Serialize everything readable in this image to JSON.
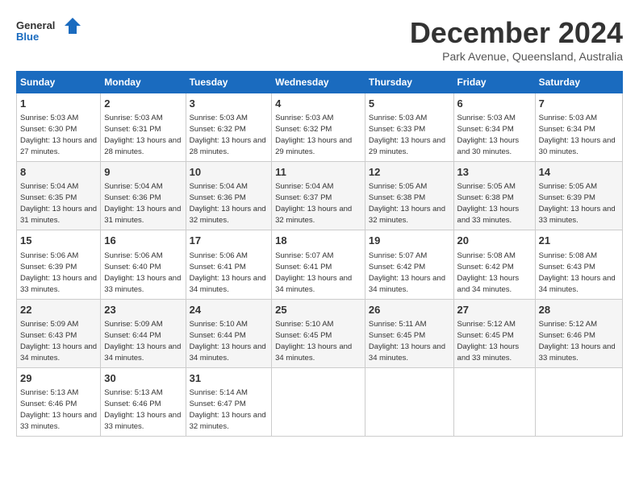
{
  "logo": {
    "general": "General",
    "blue": "Blue"
  },
  "title": "December 2024",
  "subtitle": "Park Avenue, Queensland, Australia",
  "days_header": [
    "Sunday",
    "Monday",
    "Tuesday",
    "Wednesday",
    "Thursday",
    "Friday",
    "Saturday"
  ],
  "weeks": [
    [
      {
        "day": "1",
        "sunrise": "5:03 AM",
        "sunset": "6:30 PM",
        "daylight": "13 hours and 27 minutes."
      },
      {
        "day": "2",
        "sunrise": "5:03 AM",
        "sunset": "6:31 PM",
        "daylight": "13 hours and 28 minutes."
      },
      {
        "day": "3",
        "sunrise": "5:03 AM",
        "sunset": "6:32 PM",
        "daylight": "13 hours and 28 minutes."
      },
      {
        "day": "4",
        "sunrise": "5:03 AM",
        "sunset": "6:32 PM",
        "daylight": "13 hours and 29 minutes."
      },
      {
        "day": "5",
        "sunrise": "5:03 AM",
        "sunset": "6:33 PM",
        "daylight": "13 hours and 29 minutes."
      },
      {
        "day": "6",
        "sunrise": "5:03 AM",
        "sunset": "6:34 PM",
        "daylight": "13 hours and 30 minutes."
      },
      {
        "day": "7",
        "sunrise": "5:03 AM",
        "sunset": "6:34 PM",
        "daylight": "13 hours and 30 minutes."
      }
    ],
    [
      {
        "day": "8",
        "sunrise": "5:04 AM",
        "sunset": "6:35 PM",
        "daylight": "13 hours and 31 minutes."
      },
      {
        "day": "9",
        "sunrise": "5:04 AM",
        "sunset": "6:36 PM",
        "daylight": "13 hours and 31 minutes."
      },
      {
        "day": "10",
        "sunrise": "5:04 AM",
        "sunset": "6:36 PM",
        "daylight": "13 hours and 32 minutes."
      },
      {
        "day": "11",
        "sunrise": "5:04 AM",
        "sunset": "6:37 PM",
        "daylight": "13 hours and 32 minutes."
      },
      {
        "day": "12",
        "sunrise": "5:05 AM",
        "sunset": "6:38 PM",
        "daylight": "13 hours and 32 minutes."
      },
      {
        "day": "13",
        "sunrise": "5:05 AM",
        "sunset": "6:38 PM",
        "daylight": "13 hours and 33 minutes."
      },
      {
        "day": "14",
        "sunrise": "5:05 AM",
        "sunset": "6:39 PM",
        "daylight": "13 hours and 33 minutes."
      }
    ],
    [
      {
        "day": "15",
        "sunrise": "5:06 AM",
        "sunset": "6:39 PM",
        "daylight": "13 hours and 33 minutes."
      },
      {
        "day": "16",
        "sunrise": "5:06 AM",
        "sunset": "6:40 PM",
        "daylight": "13 hours and 33 minutes."
      },
      {
        "day": "17",
        "sunrise": "5:06 AM",
        "sunset": "6:41 PM",
        "daylight": "13 hours and 34 minutes."
      },
      {
        "day": "18",
        "sunrise": "5:07 AM",
        "sunset": "6:41 PM",
        "daylight": "13 hours and 34 minutes."
      },
      {
        "day": "19",
        "sunrise": "5:07 AM",
        "sunset": "6:42 PM",
        "daylight": "13 hours and 34 minutes."
      },
      {
        "day": "20",
        "sunrise": "5:08 AM",
        "sunset": "6:42 PM",
        "daylight": "13 hours and 34 minutes."
      },
      {
        "day": "21",
        "sunrise": "5:08 AM",
        "sunset": "6:43 PM",
        "daylight": "13 hours and 34 minutes."
      }
    ],
    [
      {
        "day": "22",
        "sunrise": "5:09 AM",
        "sunset": "6:43 PM",
        "daylight": "13 hours and 34 minutes."
      },
      {
        "day": "23",
        "sunrise": "5:09 AM",
        "sunset": "6:44 PM",
        "daylight": "13 hours and 34 minutes."
      },
      {
        "day": "24",
        "sunrise": "5:10 AM",
        "sunset": "6:44 PM",
        "daylight": "13 hours and 34 minutes."
      },
      {
        "day": "25",
        "sunrise": "5:10 AM",
        "sunset": "6:45 PM",
        "daylight": "13 hours and 34 minutes."
      },
      {
        "day": "26",
        "sunrise": "5:11 AM",
        "sunset": "6:45 PM",
        "daylight": "13 hours and 34 minutes."
      },
      {
        "day": "27",
        "sunrise": "5:12 AM",
        "sunset": "6:45 PM",
        "daylight": "13 hours and 33 minutes."
      },
      {
        "day": "28",
        "sunrise": "5:12 AM",
        "sunset": "6:46 PM",
        "daylight": "13 hours and 33 minutes."
      }
    ],
    [
      {
        "day": "29",
        "sunrise": "5:13 AM",
        "sunset": "6:46 PM",
        "daylight": "13 hours and 33 minutes."
      },
      {
        "day": "30",
        "sunrise": "5:13 AM",
        "sunset": "6:46 PM",
        "daylight": "13 hours and 33 minutes."
      },
      {
        "day": "31",
        "sunrise": "5:14 AM",
        "sunset": "6:47 PM",
        "daylight": "13 hours and 32 minutes."
      },
      null,
      null,
      null,
      null
    ]
  ],
  "labels": {
    "sunrise": "Sunrise:",
    "sunset": "Sunset:",
    "daylight": "Daylight:"
  }
}
